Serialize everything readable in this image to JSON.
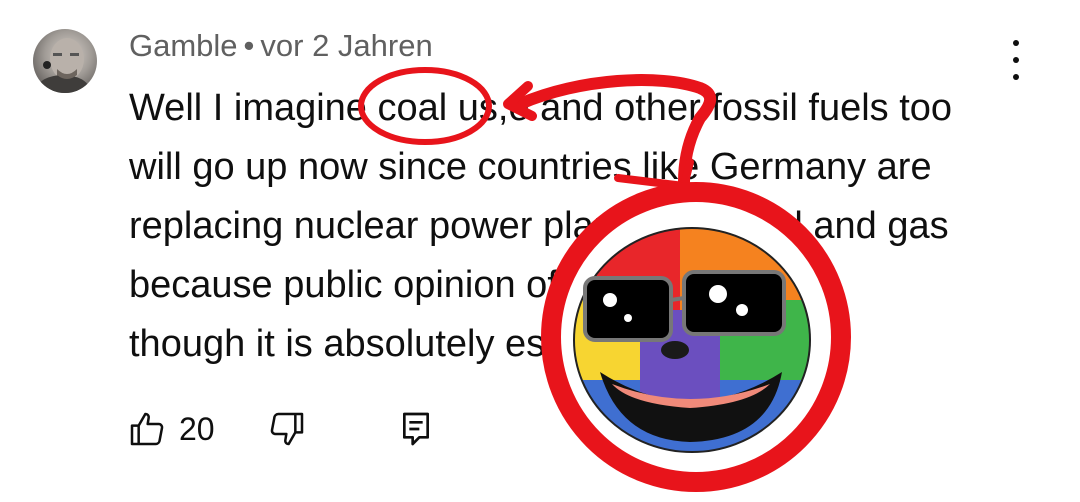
{
  "comment": {
    "author": "Gamble",
    "separator": "•",
    "time": "vor 2 Jahren",
    "lines": [
      "Well I imagine coal us,e and other fossil fuels too",
      "will go up now since countries like Germany are",
      "replacing nuclear power plants with coal and gas",
      "because public opinion of it is bad even",
      "though it is absolutely es"
    ],
    "like_count": "20"
  },
  "icons": {
    "menu": "more-vertical-icon",
    "like": "thumbs-up-icon",
    "dislike": "thumbs-down-icon",
    "reply": "reply-comment-icon"
  },
  "colors": {
    "annotation_red": "#e8141b",
    "meta_gray": "#606060",
    "text": "#0f0f0f"
  }
}
